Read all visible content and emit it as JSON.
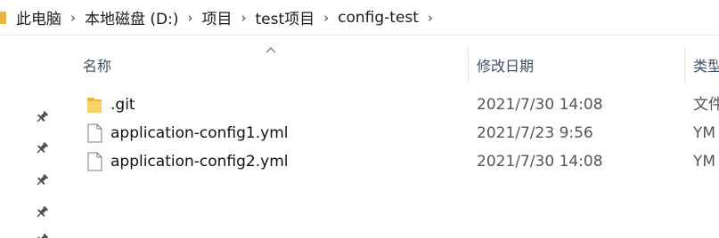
{
  "breadcrumb": {
    "items": [
      "此电脑",
      "本地磁盘 (D:)",
      "项目",
      "test项目",
      "config-test"
    ],
    "separator": "›",
    "icon": "folder-icon"
  },
  "columns": {
    "name": "名称",
    "modified": "修改日期",
    "type": "类型"
  },
  "files": [
    {
      "name": ".git",
      "modified": "2021/7/30 14:08",
      "type": "文件",
      "icon": "folder-icon"
    },
    {
      "name": "application-config1.yml",
      "modified": "2021/7/23 9:56",
      "type": "YM",
      "icon": "file-icon"
    },
    {
      "name": "application-config2.yml",
      "modified": "2021/7/30 14:08",
      "type": "YM",
      "icon": "file-icon"
    }
  ],
  "quick_access_pins": [
    "pin-icon",
    "pin-icon",
    "pin-icon",
    "pin-icon"
  ],
  "colors": {
    "folder": "#e7b53d",
    "header_text": "#3b5166",
    "date_text": "#555555"
  }
}
